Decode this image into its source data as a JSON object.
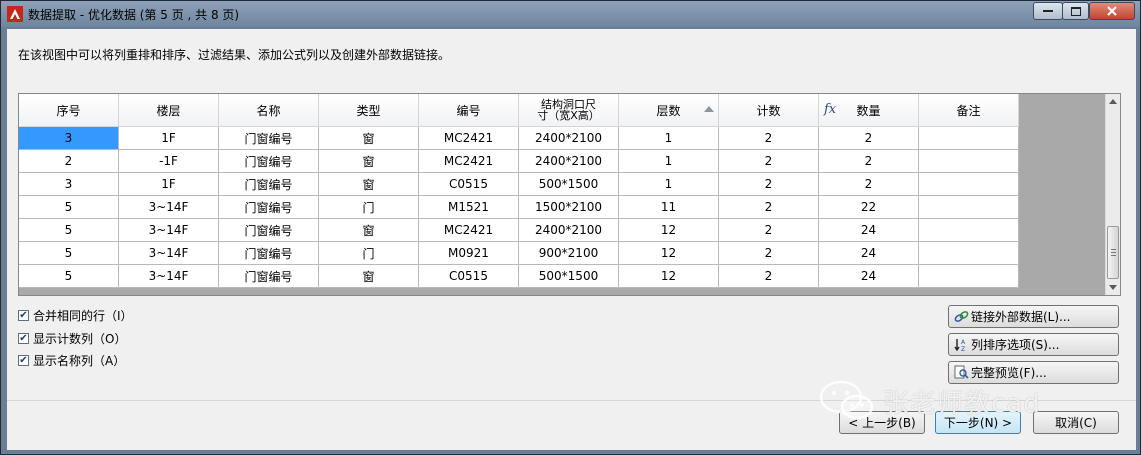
{
  "window": {
    "title": "数据提取 - 优化数据 (第 5 页 , 共 8 页)"
  },
  "description": "在该视图中可以将列重排和排序、过滤结果、添加公式列以及创建外部数据链接。",
  "table": {
    "headers": [
      "序号",
      "楼层",
      "名称",
      "类型",
      "编号",
      [
        "结构洞口尺",
        "寸（宽X高）"
      ],
      "层数",
      "计数",
      "数量",
      "备注"
    ],
    "rows": [
      [
        "3",
        "1F",
        "门窗编号",
        "窗",
        "MC2421",
        "2400*2100",
        "1",
        "2",
        "2",
        ""
      ],
      [
        "2",
        "-1F",
        "门窗编号",
        "窗",
        "MC2421",
        "2400*2100",
        "1",
        "2",
        "2",
        ""
      ],
      [
        "3",
        "1F",
        "门窗编号",
        "窗",
        "C0515",
        "500*1500",
        "1",
        "2",
        "2",
        ""
      ],
      [
        "5",
        "3~14F",
        "门窗编号",
        "门",
        "M1521",
        "1500*2100",
        "11",
        "2",
        "22",
        ""
      ],
      [
        "5",
        "3~14F",
        "门窗编号",
        "窗",
        "MC2421",
        "2400*2100",
        "12",
        "2",
        "24",
        ""
      ],
      [
        "5",
        "3~14F",
        "门窗编号",
        "门",
        "M0921",
        "900*2100",
        "12",
        "2",
        "24",
        ""
      ],
      [
        "5",
        "3~14F",
        "门窗编号",
        "窗",
        "C0515",
        "500*1500",
        "12",
        "2",
        "24",
        ""
      ]
    ],
    "sorted_column": "层数",
    "formula_column": "数量"
  },
  "options": {
    "merge_rows": {
      "label": "合并相同的行（I）",
      "checked": true
    },
    "show_count": {
      "label": "显示计数列（O）",
      "checked": true
    },
    "show_name": {
      "label": "显示名称列（A）",
      "checked": true
    }
  },
  "side_buttons": {
    "link_external": "链接外部数据(L)...",
    "sort_options": "列排序选项(S)...",
    "full_preview": "完整预览(F)..."
  },
  "nav": {
    "back": "< 上一步(B)",
    "next": "下一步(N) >",
    "cancel": "取消(C)"
  },
  "watermark": "张老师教cad",
  "colors": {
    "selection": "#3399ff",
    "title_bar": "#7b90a8",
    "close": "#c94a35"
  }
}
